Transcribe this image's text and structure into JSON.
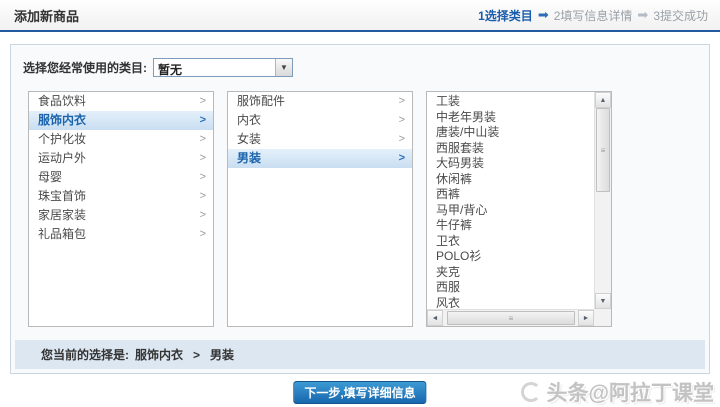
{
  "header": {
    "title": "添加新商品",
    "steps": [
      {
        "label": "1选择类目",
        "state": "active"
      },
      {
        "label": "2填写信息详情",
        "state": "idle"
      },
      {
        "label": "3提交成功",
        "state": "idle"
      }
    ]
  },
  "favorite": {
    "label": "选择您经常使用的类目:",
    "value": "暂无"
  },
  "columns": {
    "level1": {
      "selected": "服饰内衣",
      "items": [
        "食品饮料",
        "服饰内衣",
        "个护化妆",
        "运动户外",
        "母婴",
        "珠宝首饰",
        "家居家装",
        "礼品箱包"
      ]
    },
    "level2": {
      "selected": "男装",
      "items": [
        "服饰配件",
        "内衣",
        "女装",
        "男装"
      ]
    },
    "level3": {
      "selected": "",
      "items": [
        "工装",
        "中老年男装",
        "唐装/中山装",
        "西服套装",
        "大码男装",
        "休闲裤",
        "西裤",
        "马甲/背心",
        "牛仔裤",
        "卫衣",
        "POLO衫",
        "夹克",
        "西服",
        "风衣"
      ]
    }
  },
  "selection": {
    "prefix": "您当前的选择是:",
    "level1": "服饰内衣",
    "separator": ">",
    "level2": "男装"
  },
  "next_button": "下一步,填写详细信息",
  "watermark": "头条@阿拉丁课堂",
  "icons": {
    "step_arrow": "➡",
    "row_arrow": ">",
    "dropdown_arrow": "▼",
    "scroll_up": "▲",
    "scroll_down": "▼",
    "scroll_left": "◄",
    "scroll_right": "►",
    "thumb_grip": "≡"
  },
  "colors": {
    "accent_blue": "#1a5dac",
    "header_rule": "#25599f",
    "selected_row_text": "#1b64ad",
    "selected_row_bg": "#c8def1",
    "selection_bar_bg": "#dde7f2",
    "button_bg": "#1767ae"
  }
}
